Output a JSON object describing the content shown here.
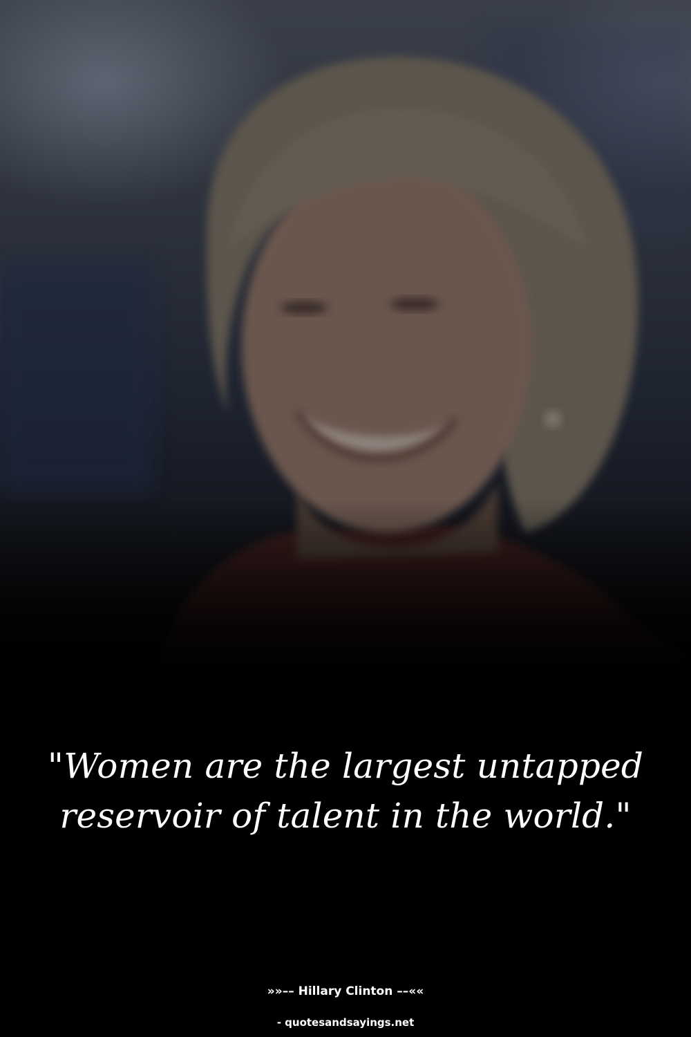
{
  "photo": {
    "subject": "smiling-woman-portrait"
  },
  "quote": {
    "text": "\"Women are the largest untapped reservoir of talent in the world.\""
  },
  "attribution": {
    "author": "»»–– Hillary Clinton ––««",
    "source": "- quotesandsayings.net"
  },
  "colors": {
    "background": "#000000",
    "text": "#ffffff"
  }
}
